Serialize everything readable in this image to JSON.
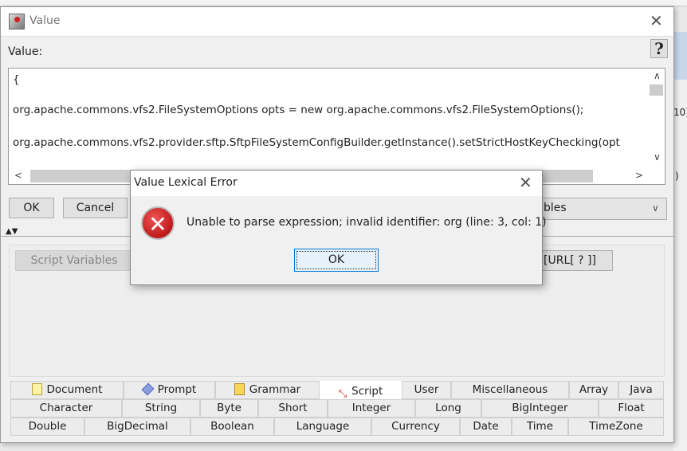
{
  "background": {
    "fragments": [
      "10)",
      ")"
    ]
  },
  "main_dialog": {
    "title": "Value",
    "help_label": "?",
    "value_label": "Value:",
    "code_lines": [
      "{",
      "org.apache.commons.vfs2.FileSystemOptions opts = new org.apache.commons.vfs2.FileSystemOptions();",
      "org.apache.commons.vfs2.provider.sftp.SftpFileSystemConfigBuilder.getInstance().setStrictHostKeyChecking(opt"
    ],
    "ok_label": "OK",
    "cancel_label": "Cancel",
    "combo_value": "bles",
    "script_variables_label": "Script Variables",
    "url_button_label": "[URL[ ? ]]",
    "tab_rows": [
      [
        "Document",
        "Prompt",
        "Grammar",
        "Script",
        "User",
        "Miscellaneous",
        "Array",
        "Java"
      ],
      [
        "Character",
        "String",
        "Byte",
        "Short",
        "Integer",
        "Long",
        "BigInteger",
        "Float"
      ],
      [
        "Double",
        "BigDecimal",
        "Boolean",
        "Language",
        "Currency",
        "Date",
        "Time",
        "TimeZone"
      ]
    ],
    "selected_tab": "Script"
  },
  "error_dialog": {
    "title": "Value Lexical Error",
    "message": "Unable to parse expression; invalid identifier: org (line: 3, col: 1)",
    "ok_label": "OK",
    "icon": "error-icon"
  }
}
